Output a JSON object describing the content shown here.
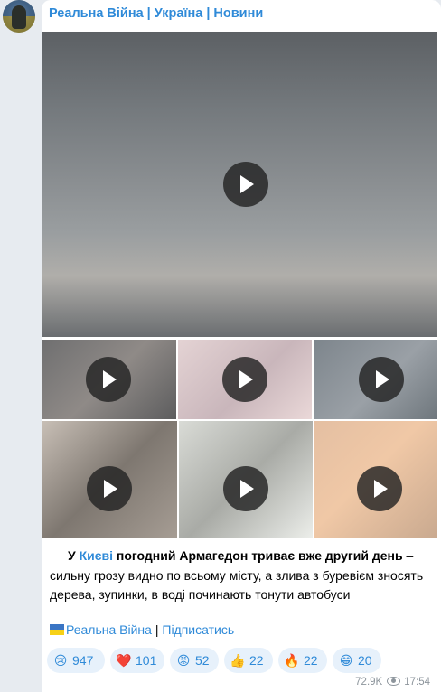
{
  "channel": {
    "name": "Реальна Війна | Україна | Новини"
  },
  "colors": {
    "accent": "#2f8ad8",
    "reaction_bg": "#e7f1fb",
    "chat_bg": "#e7ebf0"
  },
  "caption": {
    "pre": "У ",
    "link": "Києві",
    "bold": " погодний Армагедон триває вже другий день",
    "rest": " – сильну грозу видно по всьому місту, а злива з буревієм зносять дерева, зупинки, в воді починають тонути автобуси"
  },
  "footer": {
    "channel_link": "Реальна Війна",
    "separator": " | ",
    "subscribe": "Підписатись"
  },
  "reactions": [
    {
      "emoji": "😢",
      "count": "947"
    },
    {
      "emoji": "❤️",
      "count": "101"
    },
    {
      "emoji": "😡",
      "count": "52"
    },
    {
      "emoji": "👍",
      "count": "22"
    },
    {
      "emoji": "🔥",
      "count": "22"
    },
    {
      "emoji": "😁",
      "count": "20"
    }
  ],
  "meta": {
    "views": "72.9K",
    "time": "17:54"
  },
  "icons": [
    "avatar",
    "play-icon",
    "eye-icon",
    "ukraine-flag-icon"
  ]
}
